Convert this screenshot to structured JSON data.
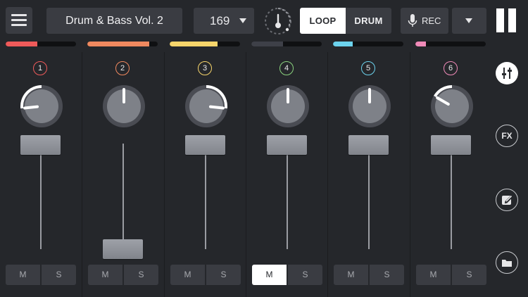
{
  "header": {
    "project_title": "Drum & Bass Vol. 2",
    "bpm": "169",
    "mode_tabs": [
      {
        "label": "LOOP",
        "active": true
      },
      {
        "label": "DRUM",
        "active": false
      }
    ],
    "rec_label": "REC"
  },
  "icons": {
    "menu": "menu-icon",
    "dropdown": "chevron-down-icon",
    "metronome": "metronome-icon",
    "mic": "mic-icon",
    "pause": "pause-icon",
    "mixer": "mixer-sliders-icon",
    "fx": "fx-icon",
    "edit": "edit-icon",
    "folder": "folder-icon"
  },
  "side_tools": {
    "fx_label": "FX"
  },
  "channels": [
    {
      "number": "1",
      "color": "#ef5a5a",
      "level": 0.45,
      "knob": 0.18,
      "fader": 1.0,
      "mute_label": "M",
      "solo_label": "S",
      "muted": false
    },
    {
      "number": "2",
      "color": "#f0895f",
      "level": 0.88,
      "knob": 0.5,
      "fader": 0.0,
      "mute_label": "M",
      "solo_label": "S",
      "muted": false
    },
    {
      "number": "3",
      "color": "#f7d56b",
      "level": 0.68,
      "knob": 0.82,
      "fader": 1.0,
      "mute_label": "M",
      "solo_label": "S",
      "muted": false
    },
    {
      "number": "4",
      "color": "#3e4048",
      "level": 0.45,
      "knob": 0.5,
      "fader": 1.0,
      "mute_label": "M",
      "solo_label": "S",
      "muted": true
    },
    {
      "number": "5",
      "color": "#6cd3ee",
      "level": 0.28,
      "knob": 0.5,
      "fader": 1.0,
      "mute_label": "M",
      "solo_label": "S",
      "muted": false
    },
    {
      "number": "6",
      "color": "#f08ab8",
      "level": 0.15,
      "knob": 0.3,
      "fader": 1.0,
      "mute_label": "M",
      "solo_label": "S",
      "muted": false
    }
  ],
  "colors": {
    "background": "#25272b",
    "panel": "#3a3c42",
    "active": "#ffffff"
  }
}
